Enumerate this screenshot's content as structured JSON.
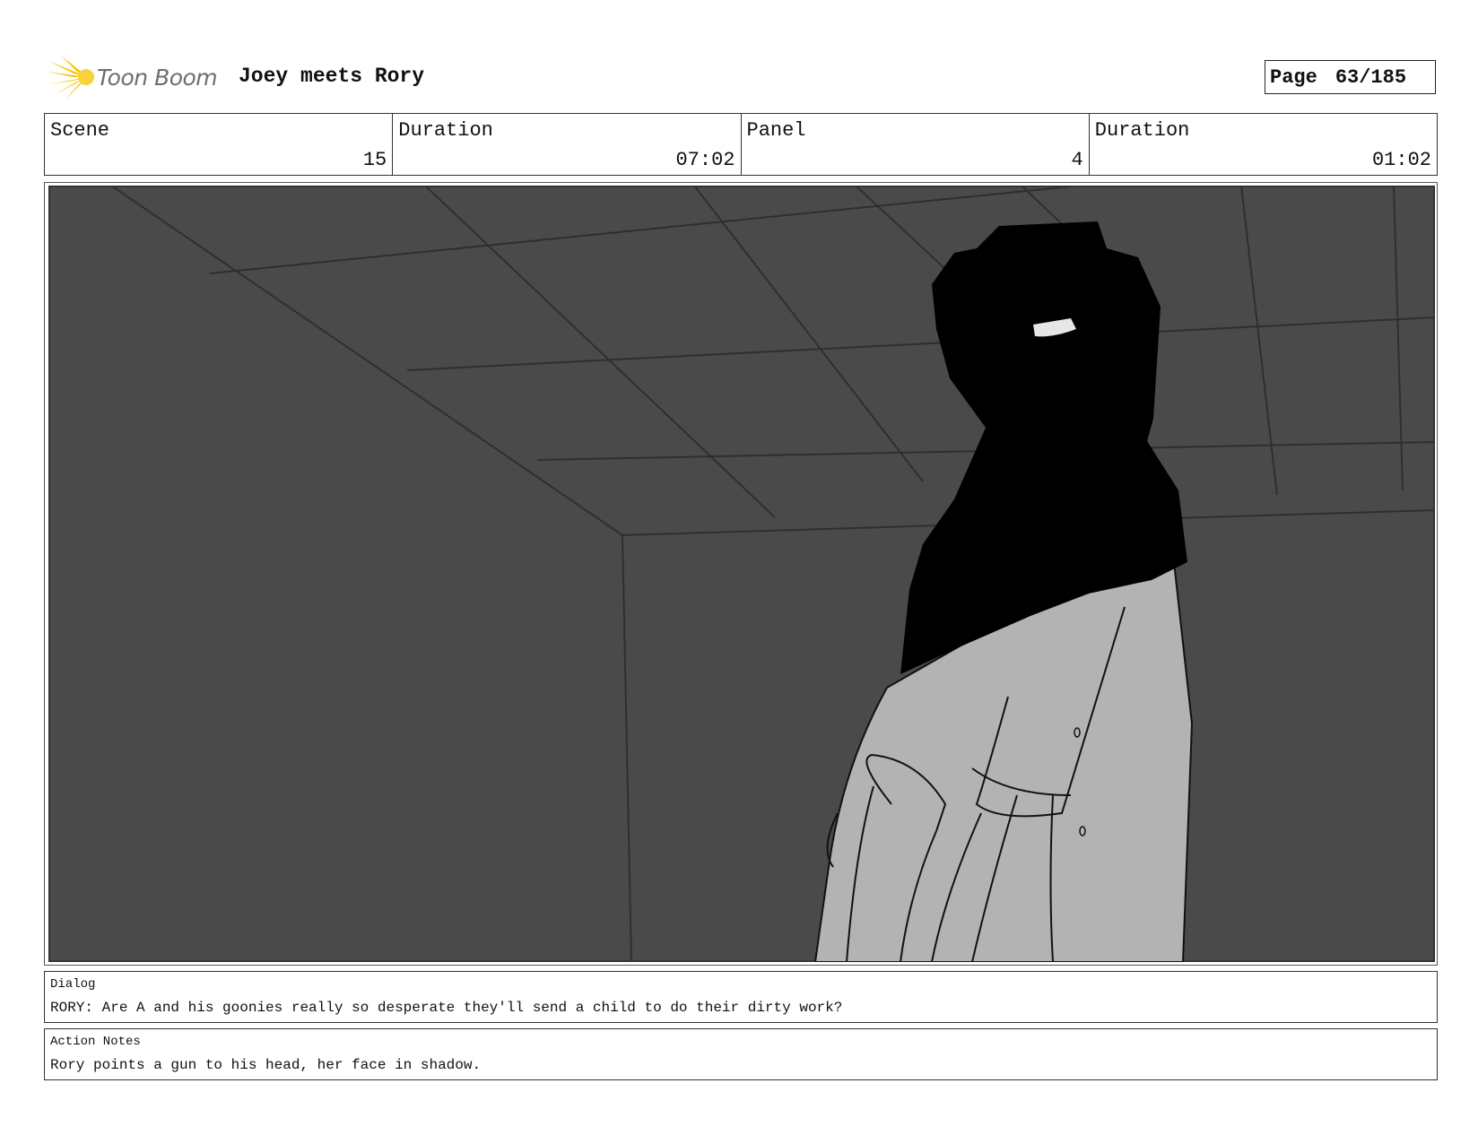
{
  "header": {
    "logo_text": "Toon Boom",
    "project_title": "Joey meets Rory",
    "page_label": "Page",
    "page_value": "63/185"
  },
  "info": {
    "scene_label": "Scene",
    "scene_value": "15",
    "scene_duration_label": "Duration",
    "scene_duration_value": "07:02",
    "panel_label": "Panel",
    "panel_value": "4",
    "panel_duration_label": "Duration",
    "panel_duration_value": "01:02"
  },
  "dialog": {
    "label": "Dialog",
    "text": "RORY: Are A and his goonies really so desperate they'll send a child to do their dirty work?"
  },
  "action_notes": {
    "label": "Action Notes",
    "text": "Rory points a gun to his head, her face in shadow."
  },
  "colors": {
    "panel_background": "#4a4a4a",
    "silhouette": "#000000",
    "clothing": "#b3b3b3",
    "logo_accent": "#f5c400"
  }
}
